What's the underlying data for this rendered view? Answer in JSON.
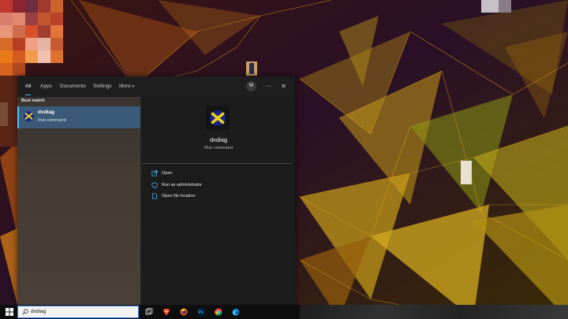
{
  "search_panel": {
    "filters": [
      "All",
      "Apps",
      "Documents",
      "Settings",
      "More"
    ],
    "more_caret": "▾",
    "account_initial": "M",
    "options_icon": "···",
    "close_icon": "✕",
    "section_title": "Best match",
    "result": {
      "name": "dxdiag",
      "type": "Run command",
      "icon": "directx-icon"
    },
    "detail": {
      "name": "dxdiag",
      "type": "Run command"
    },
    "actions": [
      {
        "label": "Open",
        "icon": "open-icon"
      },
      {
        "label": "Run as administrator",
        "icon": "shield-icon"
      },
      {
        "label": "Open file location",
        "icon": "file-location-icon"
      }
    ]
  },
  "taskbar": {
    "search_value": "dxdiag",
    "pinned_apps": [
      "task-view-icon",
      "brave-icon",
      "firefox-icon",
      "photoshop-icon",
      "chrome-icon",
      "edge-icon"
    ]
  },
  "colors": {
    "accent": "#4cc2ff",
    "panel_bg": "#202020",
    "selected_bg": "#3a5a78"
  }
}
